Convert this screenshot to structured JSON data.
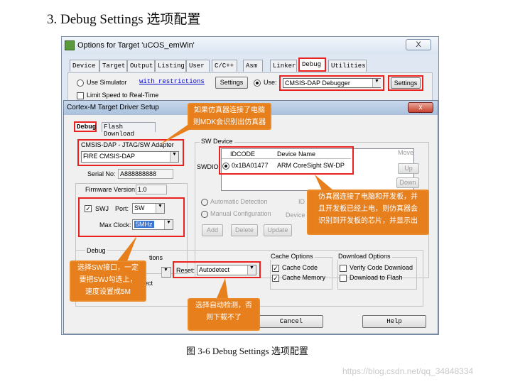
{
  "heading": "3. Debug Settings 选项配置",
  "caption": "图 3-6 Debug Settings 选项配置",
  "watermark": "https://blog.csdn.net/qq_34848334",
  "colors": {
    "annotation_border": "#e8231f",
    "callout_fill": "#e67f1c",
    "dialog_bg": "#f0f0f0"
  },
  "outer_window": {
    "title": "Options for Target 'uCOS_emWin'",
    "close_label": "X",
    "tabs": [
      "Device",
      "Target",
      "Output",
      "Listing",
      "User",
      "C/C++",
      "Asm",
      "Linker",
      "Debug",
      "Utilities"
    ],
    "active_tab": "Debug",
    "use_simulator_label": "Use Simulator",
    "restrictions_link": "with restrictions",
    "settings_left_label": "Settings",
    "use_label": "Use:",
    "debugger_value": "CMSIS-DAP Debugger",
    "settings_right_label": "Settings",
    "limit_speed_label": "Limit Speed to Real-Time"
  },
  "driver_dialog": {
    "title": "Cortex-M Target Driver Setup",
    "close_label": "x",
    "tabs": [
      "Debug",
      "Flash Download"
    ],
    "active_tab": "Debug",
    "adapter_group": "CMSIS-DAP - JTAG/SW Adapter",
    "adapter_value": "FIRE CMSIS-DAP",
    "serial_label": "Serial No:",
    "serial_value": "A888888888",
    "firmware_label": "Firmware Version:",
    "firmware_value": "1.0",
    "swj_label": "SWJ",
    "port_label": "Port:",
    "port_value": "SW",
    "max_clock_label": "Max Clock:",
    "max_clock_value": "5MHz",
    "sw_device_group": "SW Device",
    "swdio_label": "SWDIO",
    "columns": [
      "IDCODE",
      "Device Name"
    ],
    "devices": [
      {
        "idcode": "0x1BA01477",
        "name": "ARM CoreSight SW-DP"
      }
    ],
    "move_label": "Move",
    "up_label": "Up",
    "down_label": "Down",
    "automatic_detection_label": "Automatic Detection",
    "manual_configuration_label": "Manual Configuration",
    "id_label": "ID",
    "device_label": "Device",
    "add_label": "Add",
    "delete_label": "Delete",
    "update_label": "Update",
    "debug_group": "Debug",
    "options_fragment": "tions",
    "reset_label": "Reset:",
    "reset_value": "Autodetect",
    "ect_fragment": "ect",
    "cache_group": "Cache Options",
    "cache_code_label": "Cache Code",
    "cache_memory_label": "Cache Memory",
    "download_group": "Download Options",
    "verify_label": "Verify Code Download",
    "download_flash_label": "Download to Flash",
    "cancel_label": "Cancel",
    "help_label": "Help"
  },
  "callouts": {
    "top": [
      "如果仿真器连接了电脑",
      "则MDK会识别出仿真器"
    ],
    "right": [
      "仿真器连接了电脑和开发板，并",
      "且开发板已经上电，则仿真器会",
      "识别到开发板的芯片，并显示出"
    ],
    "left": [
      "选择SW接口，一定",
      "要把SWJ勾选上，",
      "速度设置成5M"
    ],
    "bottom": [
      "选择自动检测，否",
      "则下载不了"
    ]
  }
}
